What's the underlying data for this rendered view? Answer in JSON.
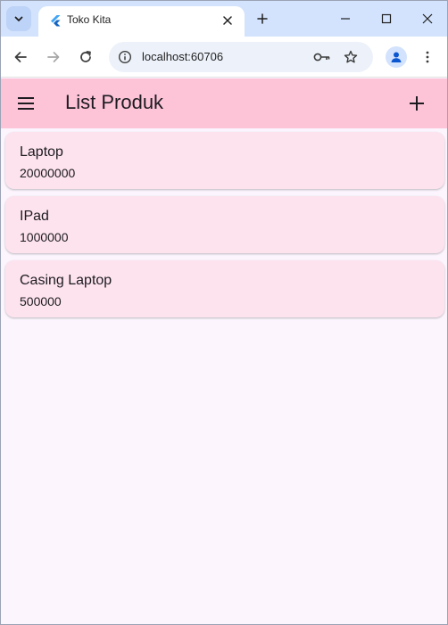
{
  "browser": {
    "tab_title": "Toko Kita",
    "url": "localhost:60706"
  },
  "app": {
    "title": "List Produk"
  },
  "products": [
    {
      "name": "Laptop",
      "price": "20000000"
    },
    {
      "name": "IPad",
      "price": "1000000"
    },
    {
      "name": "Casing Laptop",
      "price": "500000"
    }
  ],
  "colors": {
    "appbar": "#fdc4d8",
    "card": "#fde3ee",
    "background": "#fcf5fe",
    "tabstrip": "#d3e3fd"
  },
  "icons": {
    "menu": "hamburger-menu-icon",
    "add": "plus-icon",
    "favicon": "flutter-icon"
  }
}
